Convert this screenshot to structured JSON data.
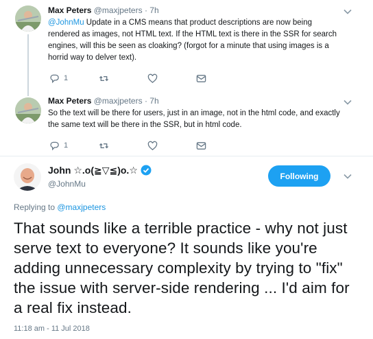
{
  "thread": [
    {
      "name": "Max Peters",
      "handle": "@maxjpeters",
      "dot": "·",
      "time": "7h",
      "mention": "@JohnMu",
      "text": " Update in a CMS means that product descriptions are now being rendered as images, not HTML text. If the HTML text is there in the SSR for search engines, will this be seen as cloaking?  (forgot for a minute that using images is a horrid way to delver text).",
      "reply_count": "1",
      "retweet_count": "",
      "like_count": ""
    },
    {
      "name": "Max Peters",
      "handle": "@maxjpeters",
      "dot": "·",
      "time": "7h",
      "text": "So the text will be there for users, just in an image, not in the html code, and exactly the same text will be there in the SSR, but in html code.",
      "reply_count": "1",
      "retweet_count": "",
      "like_count": ""
    }
  ],
  "main_tweet": {
    "name": "John ☆.o(≧▽≦)o.☆",
    "handle": "@JohnMu",
    "follow_label": "Following",
    "replying_prefix": "Replying to ",
    "replying_to": "@maxjpeters",
    "text": "That sounds like a terrible practice - why not just serve text to everyone? It sounds like you're adding unnecessary complexity by trying to \"fix\" the issue with server-side rendering ... I'd aim for a real fix instead.",
    "timestamp": "11:18 am - 11 Jul 2018"
  },
  "colors": {
    "accent": "#1da1f2",
    "link": "#1b95e0",
    "muted": "#657786",
    "text": "#14171a",
    "divider": "#e6ecf0"
  },
  "icons": [
    "reply-icon",
    "retweet-icon",
    "like-icon",
    "message-icon",
    "caret-down-icon",
    "verified-badge-icon"
  ]
}
